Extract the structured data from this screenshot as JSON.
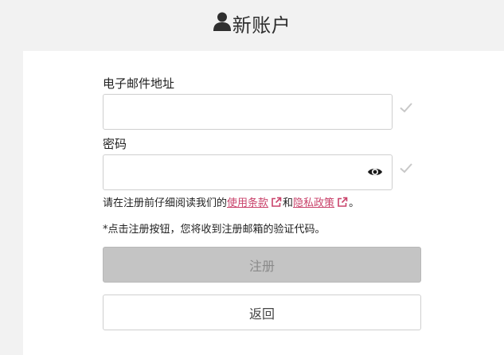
{
  "header": {
    "title": "新账户",
    "icon": "user-icon"
  },
  "form": {
    "email_label": "电子邮件地址",
    "email_value": "",
    "password_label": "密码",
    "password_value": "",
    "terms_prefix": "请在注册前仔细阅读我们的",
    "terms_link": "使用条款",
    "terms_and": "和",
    "privacy_link": "隐私政策",
    "terms_suffix": "。",
    "note": "*点击注册按钮，您将收到注册邮箱的验证代码。",
    "register_label": "注册",
    "back_label": "返回"
  },
  "colors": {
    "link": "#c9436b",
    "check": "#c8c8c8",
    "register_bg": "#c4c4c4"
  }
}
